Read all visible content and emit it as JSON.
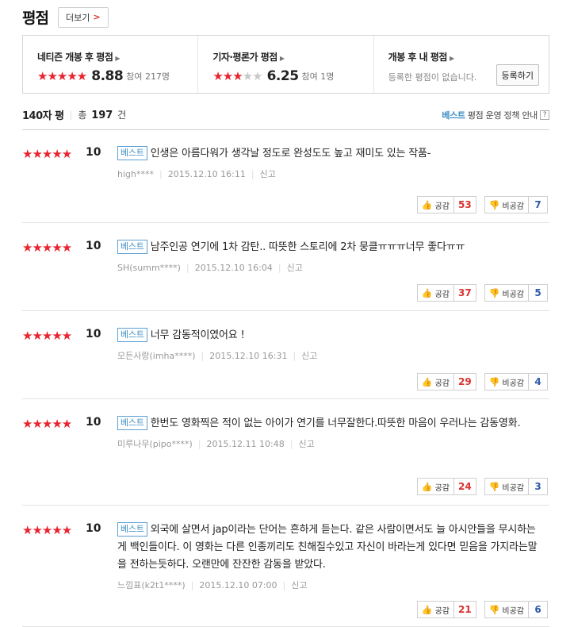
{
  "header": {
    "title": "평점",
    "more_label": "더보기"
  },
  "summary": {
    "netizen": {
      "label": "네티즌 개봉 후 평점",
      "stars_on": "★★★★★",
      "stars_off": "",
      "score": "8.88",
      "count": "참여 217명"
    },
    "critic": {
      "label": "기자·평론가 평점",
      "stars_on": "★★★",
      "stars_off": "★★",
      "score": "6.25",
      "count": "참여 1명"
    },
    "my": {
      "label": "개봉 후 내 평점",
      "text": "등록한 평점이 없습니다.",
      "register_label": "등록하기"
    }
  },
  "list_header": {
    "label": "140자 평",
    "total_prefix": "총",
    "total_count": "197",
    "total_suffix": "건",
    "best_label": "베스트",
    "policy_label": "평점 운영 정책 안내",
    "help_icon": "?"
  },
  "reviews": [
    {
      "stars": "★★★★★",
      "score": "10",
      "badge": "베스트",
      "text": "인생은 아름다워가 생각날 정도로 완성도도 높고 재미도 있는 작품-",
      "user": "high****",
      "date": "2015.12.10 16:11",
      "report": "신고",
      "like_label": "공감",
      "like_count": "53",
      "dislike_label": "비공감",
      "dislike_count": "7"
    },
    {
      "stars": "★★★★★",
      "score": "10",
      "badge": "베스트",
      "text": "남주인공 연기에 1차 감탄.. 따뜻한 스토리에 2차 뭉클ㅠㅠㅠ너무 좋다ㅠㅠ",
      "user": "SH(summ****)",
      "date": "2015.12.10 16:04",
      "report": "신고",
      "like_label": "공감",
      "like_count": "37",
      "dislike_label": "비공감",
      "dislike_count": "5"
    },
    {
      "stars": "★★★★★",
      "score": "10",
      "badge": "베스트",
      "text": "너무 감동적이였어요 !",
      "user": "모든사랑(imha****)",
      "date": "2015.12.10 16:31",
      "report": "신고",
      "like_label": "공감",
      "like_count": "29",
      "dislike_label": "비공감",
      "dislike_count": "4"
    },
    {
      "stars": "★★★★★",
      "score": "10",
      "badge": "베스트",
      "text": "한번도 영화찍은 적이 없는 아이가 연기를 너무잘한다.따뜻한 마음이 우러나는 감동영화.",
      "user": "미루나무(pipo****)",
      "date": "2015.12.11 10:48",
      "report": "신고",
      "like_label": "공감",
      "like_count": "24",
      "dislike_label": "비공감",
      "dislike_count": "3"
    },
    {
      "stars": "★★★★★",
      "score": "10",
      "badge": "베스트",
      "text": "외국에 살면서 jap이라는 단어는 흔하게 듣는다. 같은 사람이면서도 늘 아시안들을 무시하는게 백인들이다. 이 영화는 다른 인종끼리도 친해질수있고 자신이 바라는게 있다면 믿음을 가지라는말을 전하는듯하다. 오랜만에 잔잔한 감동을 받았다.",
      "user": "느낌표(k2t1****)",
      "date": "2015.12.10 07:00",
      "report": "신고",
      "like_label": "공감",
      "like_count": "21",
      "dislike_label": "비공감",
      "dislike_count": "6"
    }
  ],
  "colors": {
    "star": "#e8242f",
    "best_badge": "#3d8ec5",
    "like_count": "#d9322f",
    "dislike_count": "#2d5aa8"
  }
}
